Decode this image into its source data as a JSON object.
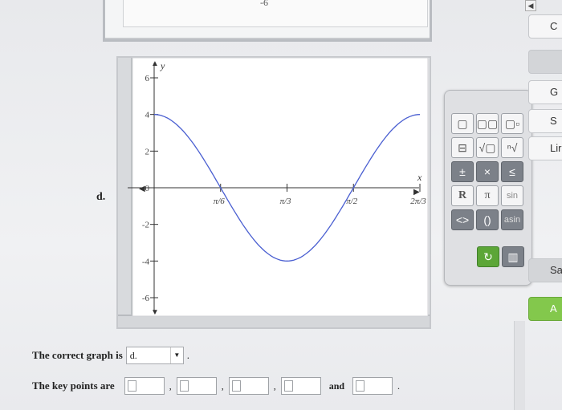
{
  "previous_graph": {
    "tick_label": "-6"
  },
  "graph": {
    "option_letter": "d.",
    "y_axis_label": "y",
    "x_axis_label": "x",
    "y_ticks": [
      "6",
      "4",
      "2",
      "0",
      "-2",
      "-4",
      "-6"
    ],
    "x_ticks": [
      "π/6",
      "π/3",
      "π/2",
      "2π/3"
    ],
    "line_color": "#4a5fd1"
  },
  "chart_data": {
    "type": "line",
    "function_points": {
      "x": [
        0,
        0.1309,
        0.2618,
        0.3927,
        0.5236,
        0.6545,
        0.7854,
        0.9163,
        1.0472,
        1.1781,
        1.309,
        1.4399,
        1.5708,
        1.7017,
        1.8326,
        1.9635,
        2.0944
      ],
      "y": [
        4,
        3.7,
        2.83,
        1.53,
        0,
        -1.53,
        -2.83,
        -3.7,
        -4,
        -3.7,
        -2.83,
        -1.53,
        0,
        1.53,
        2.83,
        3.7,
        4
      ]
    },
    "xlim": [
      -0.12,
      2.2
    ],
    "ylim": [
      -7,
      7
    ],
    "x_tick_values": [
      0.5236,
      1.0472,
      1.5708,
      2.0944
    ],
    "y_tick_values": [
      6,
      4,
      2,
      0,
      -2,
      -4,
      -6
    ]
  },
  "palette": {
    "row1": [
      "▢",
      "▢▢",
      "▢▫"
    ],
    "row2": [
      "⊟",
      "√▢",
      "ⁿ√▢"
    ],
    "row3": [
      "±",
      "×",
      "≤"
    ],
    "row4": [
      "R",
      "π",
      "sin"
    ],
    "row5": [
      "<>",
      "()",
      "asin"
    ],
    "row6": [
      "↻",
      "🗑"
    ]
  },
  "side_buttons": [
    "C",
    "G",
    "S",
    "Lir",
    "Sa",
    "A"
  ],
  "question": {
    "correct_graph_label": "The correct graph is",
    "selected_option": "d.",
    "key_points_label": "The key points are",
    "separators": [
      ",",
      ",",
      ",",
      "and",
      "."
    ]
  }
}
